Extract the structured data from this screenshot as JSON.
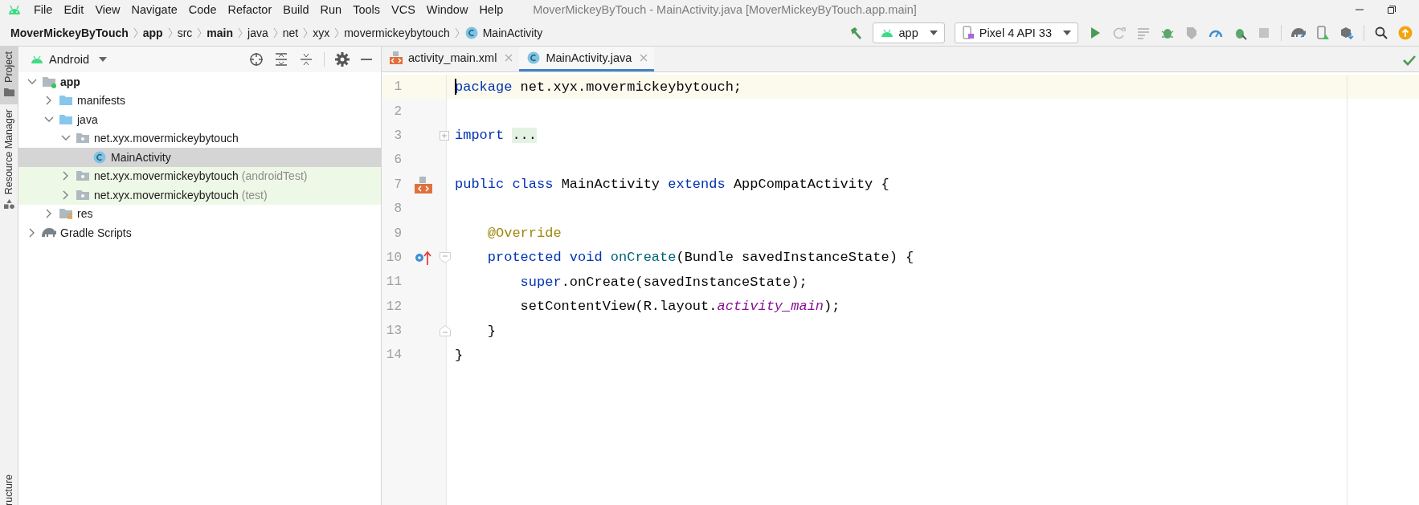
{
  "window": {
    "title": "MoverMickeyByTouch - MainActivity.java [MoverMickeyByTouch.app.main]"
  },
  "menu": [
    {
      "label": "File"
    },
    {
      "label": "Edit"
    },
    {
      "label": "View"
    },
    {
      "label": "Navigate"
    },
    {
      "label": "Code"
    },
    {
      "label": "Refactor"
    },
    {
      "label": "Build"
    },
    {
      "label": "Run"
    },
    {
      "label": "Tools"
    },
    {
      "label": "VCS"
    },
    {
      "label": "Window"
    },
    {
      "label": "Help"
    }
  ],
  "breadcrumbs": [
    {
      "label": "MoverMickeyByTouch",
      "bold": true
    },
    {
      "label": "app",
      "bold": true
    },
    {
      "label": "src",
      "bold": false
    },
    {
      "label": "main",
      "bold": true
    },
    {
      "label": "java",
      "bold": false
    },
    {
      "label": "net",
      "bold": false
    },
    {
      "label": "xyx",
      "bold": false
    },
    {
      "label": "movermickeybytouch",
      "bold": false
    },
    {
      "label": "MainActivity",
      "bold": false,
      "kind": "class"
    }
  ],
  "toolbar": {
    "run_configuration": "app",
    "device": "Pixel 4 API 33"
  },
  "tool_windows": [
    {
      "label": "Project",
      "selected": true,
      "kind": "folder"
    },
    {
      "label": "Resource Manager",
      "selected": false,
      "kind": "shapes"
    }
  ],
  "bottom_tool_windows": [
    {
      "label": "ructure",
      "selected": false
    }
  ],
  "project": {
    "view": "Android",
    "tree": [
      {
        "label": "app",
        "kind": "module",
        "bold": true,
        "expanded": true,
        "selected": false,
        "highlighted": false,
        "children": [
          {
            "label": "manifests",
            "kind": "folder",
            "expanded": false,
            "selected": false,
            "highlighted": false
          },
          {
            "label": "java",
            "kind": "folder",
            "expanded": true,
            "selected": false,
            "highlighted": false,
            "children": [
              {
                "label": "net.xyx.movermickeybytouch",
                "kind": "package",
                "expanded": true,
                "selected": false,
                "highlighted": false,
                "children": [
                  {
                    "label": "MainActivity",
                    "kind": "class",
                    "selected": true,
                    "highlighted": false
                  }
                ]
              },
              {
                "label": "net.xyx.movermickeybytouch",
                "suffix": "(androidTest)",
                "kind": "package",
                "expanded": false,
                "selected": false,
                "highlighted": true
              },
              {
                "label": "net.xyx.movermickeybytouch",
                "suffix": "(test)",
                "kind": "package",
                "expanded": false,
                "selected": false,
                "highlighted": true
              }
            ]
          },
          {
            "label": "res",
            "kind": "resfolder",
            "expanded": false,
            "selected": false,
            "highlighted": false
          }
        ]
      },
      {
        "label": "Gradle Scripts",
        "kind": "gradle",
        "expanded": false,
        "selected": false,
        "highlighted": false
      }
    ]
  },
  "editor": {
    "tabs": [
      {
        "label": "activity_main.xml",
        "kind": "xml",
        "selected": false
      },
      {
        "label": "MainActivity.java",
        "kind": "class",
        "selected": true
      }
    ],
    "lines": [
      {
        "number": "1",
        "current": true,
        "tokens": [
          {
            "text": "package",
            "kind": "keyword"
          },
          {
            "text": " net.xyx.movermickeybytouch;",
            "kind": "plain"
          }
        ]
      },
      {
        "number": "2",
        "current": false
      },
      {
        "number": "3",
        "current": false,
        "fold": {
          "kind": "expand"
        },
        "tokens": [
          {
            "text": "import ",
            "kind": "keyword"
          },
          {
            "text": "...",
            "kind": "folded"
          }
        ]
      },
      {
        "number": "6",
        "current": false
      },
      {
        "number": "7",
        "current": false,
        "marker": {
          "kind": "layout"
        },
        "tokens": [
          {
            "text": "public ",
            "kind": "keyword"
          },
          {
            "text": "class",
            "kind": "keyword"
          },
          {
            "text": " MainActivity ",
            "kind": "plain"
          },
          {
            "text": "extends",
            "kind": "keyword"
          },
          {
            "text": " AppCompatActivity {",
            "kind": "plain"
          }
        ]
      },
      {
        "number": "8",
        "current": false
      },
      {
        "number": "9",
        "current": false,
        "tokens": [
          {
            "text": "    @Override",
            "kind": "annotation"
          }
        ]
      },
      {
        "number": "10",
        "current": false,
        "marker": {
          "kind": "override"
        },
        "fold": {
          "kind": "start"
        },
        "tokens": [
          {
            "text": "    protected ",
            "kind": "keyword"
          },
          {
            "text": "void ",
            "kind": "keyword"
          },
          {
            "text": "onCreate",
            "kind": "declaration"
          },
          {
            "text": "(Bundle savedInstanceState) {",
            "kind": "plain"
          }
        ]
      },
      {
        "number": "11",
        "current": false,
        "tokens": [
          {
            "text": "        super",
            "kind": "keyword"
          },
          {
            "text": ".onCreate(savedInstanceState);",
            "kind": "plain"
          }
        ]
      },
      {
        "number": "12",
        "current": false,
        "tokens": [
          {
            "text": "        setContentView(R.layout.",
            "kind": "plain"
          },
          {
            "text": "activity_main",
            "kind": "field"
          },
          {
            "text": ");",
            "kind": "plain"
          }
        ]
      },
      {
        "number": "13",
        "current": false,
        "fold": {
          "kind": "end"
        },
        "tokens": [
          {
            "text": "    }",
            "kind": "plain"
          }
        ]
      },
      {
        "number": "14",
        "current": false,
        "tokens": [
          {
            "text": "}",
            "kind": "plain"
          }
        ]
      }
    ]
  }
}
